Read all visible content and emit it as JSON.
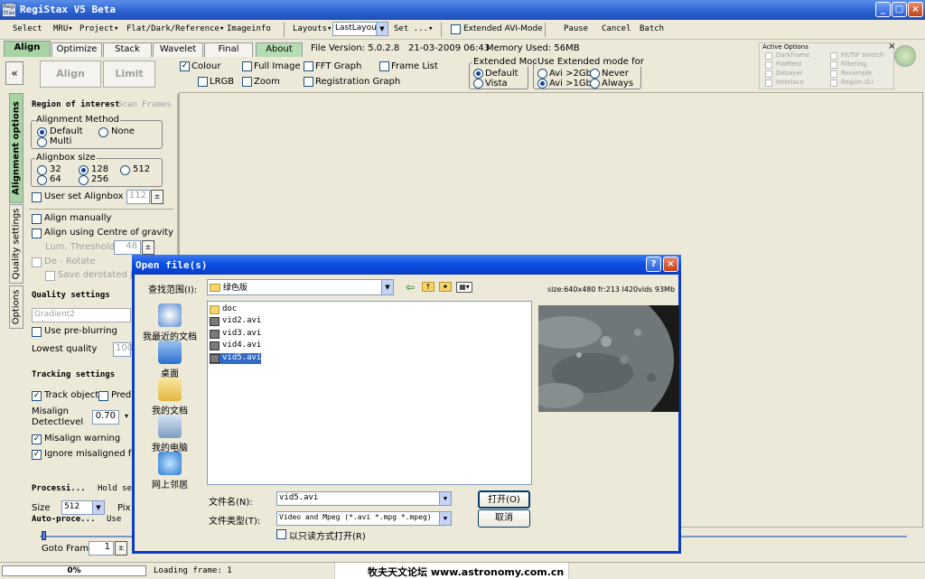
{
  "window": {
    "title": "RegiStax V5 Beta",
    "app_icon_text": "Regi Stax"
  },
  "menu": {
    "items": [
      "Select",
      "MRU",
      "Project",
      "Flat/Dark/Reference",
      "Imageinfo",
      "Layouts",
      "Set ..."
    ],
    "layout_value": "LastLayout",
    "extended_avi": "Extended AVI-Mode",
    "pause": "Pause",
    "cancel": "Cancel",
    "batch": "Batch"
  },
  "tabs": [
    "Align",
    "Optimize",
    "Stack",
    "Wavelet",
    "Final",
    "About"
  ],
  "info": {
    "version": "File Version: 5.0.2.8",
    "datetime": "21-03-2009 06:43",
    "memory": "Memory Used: 56MB"
  },
  "active_options": {
    "title": "Active Options",
    "left": [
      "Darkframe",
      "Flatfield",
      "Debayer",
      "Interlace"
    ],
    "right": [
      "Fit/TIF stretch",
      "Filtering",
      "Resample",
      "Region.O.I."
    ]
  },
  "toolbar": {
    "collapse": "«",
    "align": "Align",
    "limit": "Limit",
    "checks": [
      {
        "label": "Colour",
        "checked": true
      },
      {
        "label": "Full Image",
        "checked": false
      },
      {
        "label": "FFT Graph",
        "checked": false
      },
      {
        "label": "Frame List",
        "checked": false
      },
      {
        "label": "LRGB",
        "checked": false
      },
      {
        "label": "Zoom",
        "checked": false
      },
      {
        "label": "Registration Graph",
        "checked": false
      }
    ],
    "extended_mode": {
      "title": "Extended Mode",
      "options": [
        "Default",
        "Vista"
      ],
      "selected": 0
    },
    "use_extended": {
      "title": "Use  Extended mode for",
      "options": [
        "Avi >2Gb",
        "Never",
        "Avi >1Gb",
        "Always"
      ],
      "selected": 2
    }
  },
  "side_tabs": [
    "Alignment options",
    "Quality settings",
    "Options"
  ],
  "left": {
    "roi": "Region of interest",
    "scan_frames": "Scan Frames",
    "align_method": {
      "title": "Alignment Method",
      "options": [
        "Default",
        "None",
        "Multi"
      ],
      "selected": 0
    },
    "alignbox": {
      "title": "Alignbox size",
      "options": [
        "32",
        "128",
        "512",
        "64",
        "256"
      ],
      "selected": 1
    },
    "user_set": "User set Alignbox",
    "user_set_value": "112",
    "align_manually": "Align manually",
    "align_cog": "Align using Centre of gravity",
    "lum_threshold": "Lum. Threshold",
    "lum_value": "48",
    "derotate": "De - Rotate",
    "save_derotated": "Save derotated JP",
    "quality_header": "Quality settings",
    "quality_combo": "Gradient2",
    "pre_blur": "Use pre-blurring",
    "lowest_quality": "Lowest quality",
    "lowest_value": "100",
    "tracking_header": "Tracking settings",
    "track_object": "Track object",
    "predict": "Predi",
    "misalign": "Misalign Detectlevel",
    "misalign_value": "0.70",
    "misalign_warning": "Misalign warning",
    "ignore_misaligned": "Ignore misaligned fra",
    "processing": "Processi...",
    "hold": "Hold set",
    "size_label": "Size",
    "size_value": "512",
    "pix": "Pix",
    "auto_proc": "Auto-proce...",
    "use": "Use"
  },
  "goto": {
    "label": "Goto Frame",
    "value": "1"
  },
  "status": {
    "progress": "0%",
    "progress_value": 0,
    "loading": "Loading frame: 1",
    "watermark": "牧夫天文论坛 www.astronomy.com.cn"
  },
  "dialog": {
    "title": "Open file(s)",
    "look_in_label": "查找范围(I):",
    "look_in_value": "绿色版",
    "size_info": "size:640x480 fr:213 I420vids 93Mb",
    "places": [
      "我最近的文档",
      "桌面",
      "我的文档",
      "我的电脑",
      "网上邻居"
    ],
    "files": [
      {
        "name": "doc",
        "type": "folder"
      },
      {
        "name": "vid2.avi",
        "type": "file"
      },
      {
        "name": "vid3.avi",
        "type": "file"
      },
      {
        "name": "vid4.avi",
        "type": "file"
      },
      {
        "name": "vid5.avi",
        "type": "file",
        "selected": true
      }
    ],
    "filename_label": "文件名(N):",
    "filename_value": "vid5.avi",
    "filetype_label": "文件类型(T):",
    "filetype_value": "Video and Mpeg (*.avi *.mpg *.mpeg)",
    "readonly_label": "以只读方式打开(R)",
    "open_btn": "打开(O)",
    "cancel_btn": "取消"
  }
}
